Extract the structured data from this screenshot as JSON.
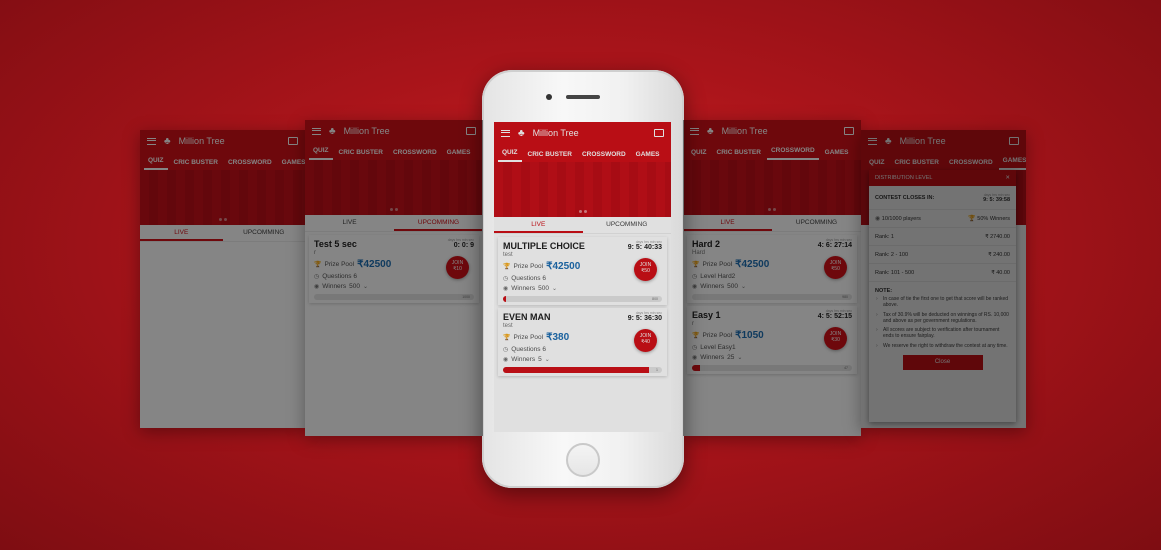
{
  "app_title": "Million Tree",
  "tabs": [
    "QUIZ",
    "CRIC BUSTER",
    "CROSSWORD",
    "GAMES"
  ],
  "subtabs": [
    "LIVE",
    "UPCOMMING"
  ],
  "card_labels": {
    "prize_pool": "Prize Pool",
    "winners": "Winners",
    "timer_small": "days hrs min sec",
    "join": "JOIN"
  },
  "screen2_card": {
    "title": "Test 5 sec",
    "desc": "r",
    "timer": "0: 0: 9",
    "prize": "₹42500",
    "line2": "Questions 6",
    "winners": "500",
    "fee": "₹10",
    "bar_label": "1000",
    "progress": 0
  },
  "phone_cards": [
    {
      "title": "MULTIPLE CHOICE",
      "desc": "test",
      "timer": "9: 5: 40:33",
      "prize": "₹42500",
      "line2": "Questions 6",
      "winners": "500",
      "fee": "₹50",
      "bar_label": "800",
      "progress": 0.02
    },
    {
      "title": "EVEN MAN",
      "desc": "test",
      "timer": "9: 5: 36:30",
      "prize": "₹380",
      "line2": "Questions 6",
      "winners": "5",
      "fee": "₹40",
      "bar_label": "1",
      "progress": 0.92
    }
  ],
  "screen4_cards": [
    {
      "title": "Hard 2",
      "desc": "Hard",
      "timer": "4: 6: 27:14",
      "prize": "₹42500",
      "line2": "Level Hard2",
      "winners": "500",
      "fee": "₹50",
      "bar_label": "980",
      "progress": 0.0
    },
    {
      "title": "Easy 1",
      "desc": "r",
      "timer": "4: 5: 52:15",
      "prize": "₹1050",
      "line2": "Level Easy1",
      "winners": "25",
      "fee": "₹30",
      "bar_label": "47",
      "progress": 0.05
    }
  ],
  "dialog": {
    "header": "DISTRIBUTION LEVEL",
    "closes_label": "CONTEST CLOSES IN:",
    "closes_timer": "9: 5: 39:58",
    "players": "10/1000 players",
    "winners_pct": "50% Winners",
    "ranks": [
      {
        "rank": "Rank: 1",
        "amount": "₹ 2740.00"
      },
      {
        "rank": "Rank: 2 - 100",
        "amount": "₹ 240.00"
      },
      {
        "rank": "Rank: 101 - 500",
        "amount": "₹ 40.00"
      }
    ],
    "note_title": "NOTE:",
    "notes": [
      "In case of tie the first one to get that score will be ranked above.",
      "Tax of 30.9% will be deducted on winnings of RS. 10,000 and above as per government regulations.",
      "All scores are subject to verification after tournament ends to ensure fairplay.",
      "We reserve the right to withdraw the contest at any time."
    ],
    "close_label": "Close"
  }
}
